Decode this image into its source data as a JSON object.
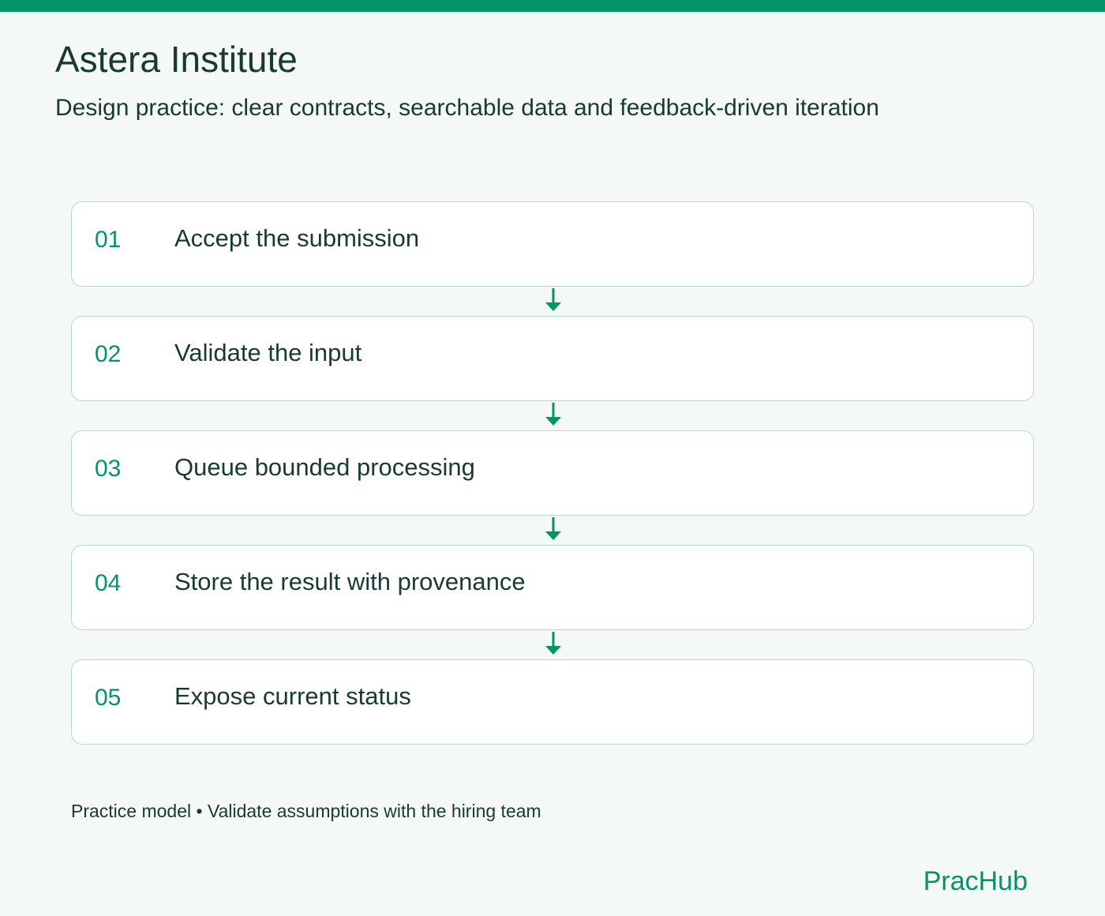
{
  "header": {
    "title": "Astera Institute",
    "subtitle": "Design practice: clear contracts, searchable data and feedback-driven iteration"
  },
  "steps": [
    {
      "number": "01",
      "label": "Accept the submission"
    },
    {
      "number": "02",
      "label": "Validate the input"
    },
    {
      "number": "03",
      "label": "Queue bounded processing"
    },
    {
      "number": "04",
      "label": "Store the result with provenance"
    },
    {
      "number": "05",
      "label": "Expose current status"
    }
  ],
  "footer": {
    "note": "Practice model • Validate assumptions with the hiring team",
    "brand": "PracHub"
  },
  "colors": {
    "accent": "#039467",
    "text": "#183a33",
    "background": "#f4f8f6",
    "card_border": "#b8d8cc"
  },
  "icons": {
    "connector": "arrow-down-icon"
  }
}
